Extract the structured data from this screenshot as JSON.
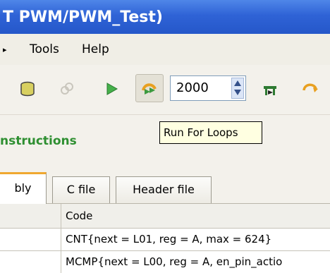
{
  "window": {
    "title": "T PWM/PWM_Test)"
  },
  "menu": {
    "fragment": "▸",
    "tools": "Tools",
    "help": "Help"
  },
  "toolbar": {
    "icons": [
      "database-icon",
      "chain-icon",
      "run-icon",
      "run-for-loops-icon",
      "breakpoint-icon",
      "step-over-icon"
    ],
    "loop_count": "2000",
    "tooltip": "Run For Loops"
  },
  "section": {
    "title": "nstructions"
  },
  "tabs": [
    {
      "label": "bly",
      "active": true
    },
    {
      "label": "C file",
      "active": false
    },
    {
      "label": "Header file",
      "active": false
    }
  ],
  "table": {
    "header": "Code",
    "rows": [
      "CNT{next = L01, reg = A, max = 624}",
      "MCMP{next = L00, reg = A, en_pin_actio"
    ]
  },
  "colors": {
    "title_bar": "#2f63d6",
    "section_title": "#2e8f31",
    "active_tab_accent": "#f0a830"
  }
}
